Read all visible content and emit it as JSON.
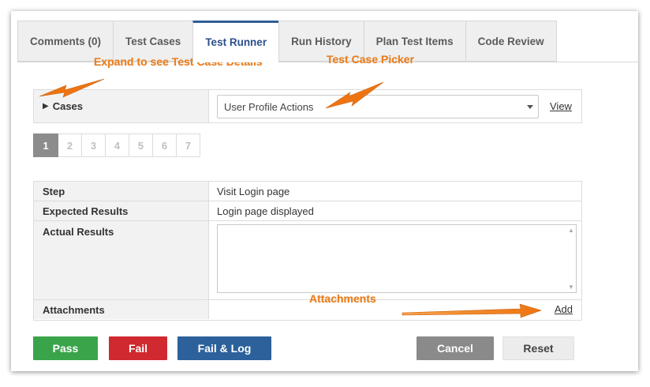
{
  "tabs": [
    {
      "label": "Comments (0)"
    },
    {
      "label": "Test Cases"
    },
    {
      "label": "Test Runner",
      "active": true
    },
    {
      "label": "Run History"
    },
    {
      "label": "Plan Test Items"
    },
    {
      "label": "Code Review"
    }
  ],
  "cases": {
    "label": "Cases",
    "selected": "User Profile Actions",
    "view_link": "View"
  },
  "pager": {
    "pages": [
      "1",
      "2",
      "3",
      "4",
      "5",
      "6",
      "7"
    ],
    "current": "1"
  },
  "step": {
    "step_label": "Step",
    "step_value": "Visit Login page",
    "expected_label": "Expected Results",
    "expected_value": "Login page displayed",
    "actual_label": "Actual Results",
    "actual_value": "",
    "attachments_label": "Attachments",
    "add_link": "Add"
  },
  "buttons": {
    "pass": "Pass",
    "fail": "Fail",
    "fail_log": "Fail & Log",
    "cancel": "Cancel",
    "reset": "Reset"
  },
  "annotations": {
    "expand": "Expand to see Test Case Details",
    "picker": "Test Case Picker",
    "attachments": "Attachments"
  },
  "colors": {
    "pass": "#3aa44a",
    "fail": "#d0292f",
    "fail_log": "#2c619b",
    "cancel": "#8a8a8a",
    "annotation": "#f07d16",
    "active_tab": "#2f5d99"
  },
  "icons": {
    "expand": "triangle-right-icon",
    "dropdown": "chevron-down-icon",
    "arrow": "callout-arrow-icon"
  }
}
